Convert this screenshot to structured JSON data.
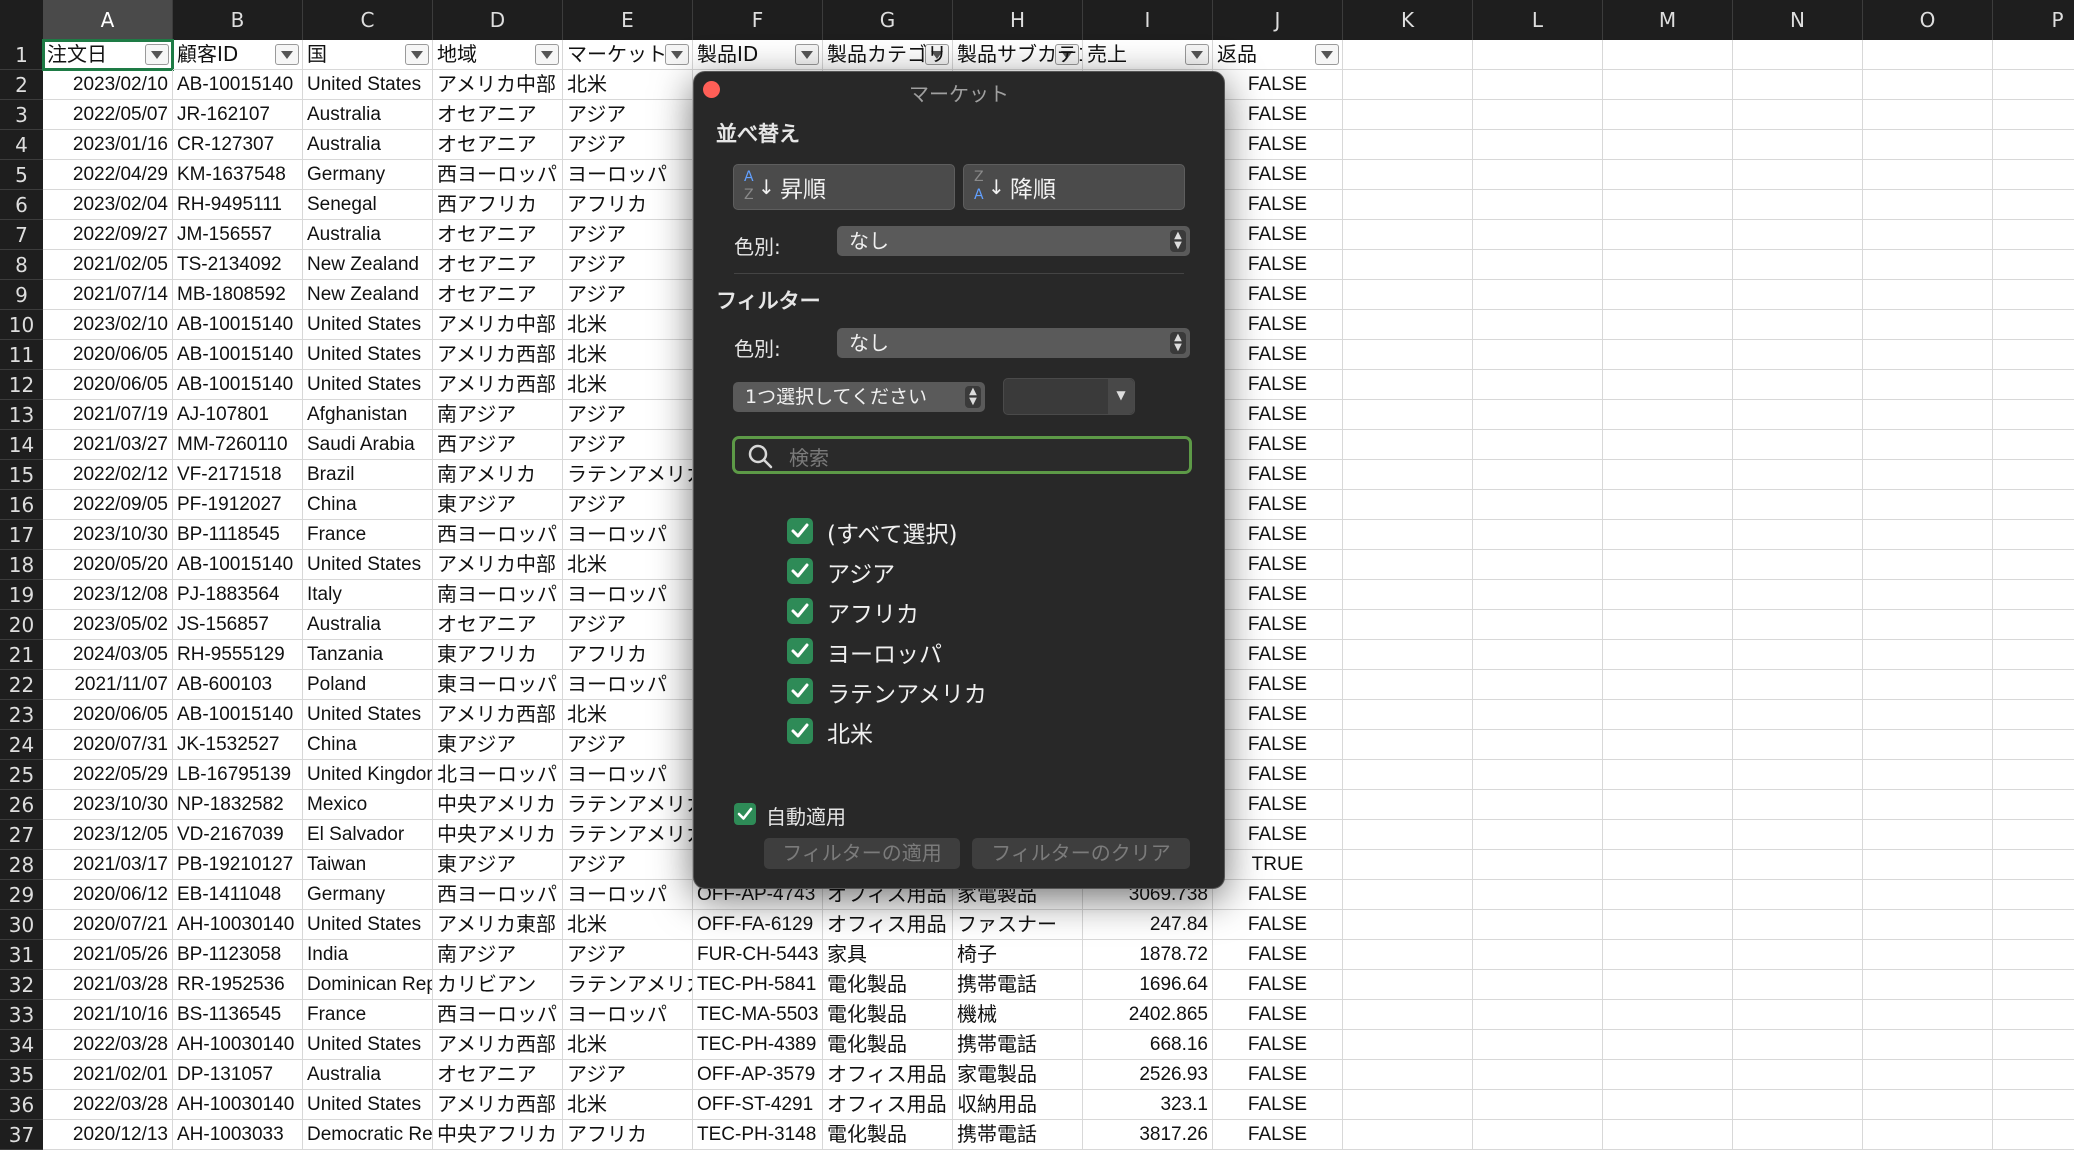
{
  "columns": [
    "A",
    "B",
    "C",
    "D",
    "E",
    "F",
    "G",
    "H",
    "I",
    "J",
    "K",
    "L",
    "M",
    "N",
    "O",
    "P"
  ],
  "selected_column": "A",
  "header_row": [
    "注文日",
    "顧客ID",
    "国",
    "地域",
    "マーケット",
    "製品ID",
    "製品カテゴリ",
    "製品サブカテゴリ",
    "売上",
    "返品"
  ],
  "rows": [
    [
      "1",
      "",
      "",
      "",
      "",
      "",
      "",
      "",
      "",
      ""
    ],
    [
      "2",
      "2023/02/10",
      "AB-10015140",
      "United States",
      "アメリカ中部",
      "北米",
      "",
      "",
      "",
      "FALSE"
    ],
    [
      "3",
      "2022/05/07",
      "JR-162107",
      "Australia",
      "オセアニア",
      "アジア",
      "",
      "",
      "",
      "FALSE"
    ],
    [
      "4",
      "2023/01/16",
      "CR-127307",
      "Australia",
      "オセアニア",
      "アジア",
      "",
      "",
      "",
      "FALSE"
    ],
    [
      "5",
      "2022/04/29",
      "KM-1637548",
      "Germany",
      "西ヨーロッパ",
      "ヨーロッパ",
      "",
      "",
      "",
      "FALSE"
    ],
    [
      "6",
      "2023/02/04",
      "RH-9495111",
      "Senegal",
      "西アフリカ",
      "アフリカ",
      "",
      "",
      "",
      "FALSE"
    ],
    [
      "7",
      "2022/09/27",
      "JM-156557",
      "Australia",
      "オセアニア",
      "アジア",
      "",
      "",
      "",
      "FALSE"
    ],
    [
      "8",
      "2021/02/05",
      "TS-2134092",
      "New Zealand",
      "オセアニア",
      "アジア",
      "",
      "",
      "",
      "FALSE"
    ],
    [
      "9",
      "2021/07/14",
      "MB-1808592",
      "New Zealand",
      "オセアニア",
      "アジア",
      "",
      "",
      "",
      "FALSE"
    ],
    [
      "10",
      "2023/02/10",
      "AB-10015140",
      "United States",
      "アメリカ中部",
      "北米",
      "",
      "",
      "",
      "FALSE"
    ],
    [
      "11",
      "2020/06/05",
      "AB-10015140",
      "United States",
      "アメリカ西部",
      "北米",
      "",
      "",
      "",
      "FALSE"
    ],
    [
      "12",
      "2020/06/05",
      "AB-10015140",
      "United States",
      "アメリカ西部",
      "北米",
      "",
      "",
      "",
      "FALSE"
    ],
    [
      "13",
      "2021/07/19",
      "AJ-107801",
      "Afghanistan",
      "南アジア",
      "アジア",
      "",
      "",
      "",
      "FALSE"
    ],
    [
      "14",
      "2021/03/27",
      "MM-7260110",
      "Saudi Arabia",
      "西アジア",
      "アジア",
      "",
      "",
      "",
      "FALSE"
    ],
    [
      "15",
      "2022/02/12",
      "VF-2171518",
      "Brazil",
      "南アメリカ",
      "ラテンアメリカ",
      "",
      "",
      "",
      "FALSE"
    ],
    [
      "16",
      "2022/09/05",
      "PF-1912027",
      "China",
      "東アジア",
      "アジア",
      "",
      "",
      "",
      "FALSE"
    ],
    [
      "17",
      "2023/10/30",
      "BP-1118545",
      "France",
      "西ヨーロッパ",
      "ヨーロッパ",
      "",
      "",
      "",
      "FALSE"
    ],
    [
      "18",
      "2020/05/20",
      "AB-10015140",
      "United States",
      "アメリカ中部",
      "北米",
      "",
      "",
      "",
      "FALSE"
    ],
    [
      "19",
      "2023/12/08",
      "PJ-1883564",
      "Italy",
      "南ヨーロッパ",
      "ヨーロッパ",
      "",
      "",
      "",
      "FALSE"
    ],
    [
      "20",
      "2023/05/02",
      "JS-156857",
      "Australia",
      "オセアニア",
      "アジア",
      "",
      "",
      "",
      "FALSE"
    ],
    [
      "21",
      "2024/03/05",
      "RH-9555129",
      "Tanzania",
      "東アフリカ",
      "アフリカ",
      "",
      "",
      "",
      "FALSE"
    ],
    [
      "22",
      "2021/11/07",
      "AB-600103",
      "Poland",
      "東ヨーロッパ",
      "ヨーロッパ",
      "",
      "",
      "",
      "FALSE"
    ],
    [
      "23",
      "2020/06/05",
      "AB-10015140",
      "United States",
      "アメリカ西部",
      "北米",
      "",
      "",
      "",
      "FALSE"
    ],
    [
      "24",
      "2020/07/31",
      "JK-1532527",
      "China",
      "東アジア",
      "アジア",
      "",
      "",
      "",
      "FALSE"
    ],
    [
      "25",
      "2022/05/29",
      "LB-16795139",
      "United Kingdom",
      "北ヨーロッパ",
      "ヨーロッパ",
      "",
      "",
      "",
      "FALSE"
    ],
    [
      "26",
      "2023/10/30",
      "NP-1832582",
      "Mexico",
      "中央アメリカ",
      "ラテンアメリカ",
      "",
      "",
      "",
      "FALSE"
    ],
    [
      "27",
      "2023/12/05",
      "VD-2167039",
      "El Salvador",
      "中央アメリカ",
      "ラテンアメリカ",
      "",
      "",
      "",
      "FALSE"
    ],
    [
      "28",
      "2021/03/17",
      "PB-19210127",
      "Taiwan",
      "東アジア",
      "アジア",
      "",
      "",
      "",
      "TRUE"
    ],
    [
      "29",
      "2020/06/12",
      "EB-1411048",
      "Germany",
      "西ヨーロッパ",
      "ヨーロッパ",
      "OFF-AP-4743",
      "オフィス用品",
      "家電製品",
      "3069.738",
      "FALSE"
    ],
    [
      "30",
      "2020/07/21",
      "AH-10030140",
      "United States",
      "アメリカ東部",
      "北米",
      "OFF-FA-6129",
      "オフィス用品",
      "ファスナー",
      "247.84",
      "FALSE"
    ],
    [
      "31",
      "2021/05/26",
      "BP-1123058",
      "India",
      "南アジア",
      "アジア",
      "FUR-CH-5443",
      "家具",
      "椅子",
      "1878.72",
      "FALSE"
    ],
    [
      "32",
      "2021/03/28",
      "RR-1952536",
      "Dominican Republic",
      "カリビアン",
      "ラテンアメリカ",
      "TEC-PH-5841",
      "電化製品",
      "携帯電話",
      "1696.64",
      "FALSE"
    ],
    [
      "33",
      "2021/10/16",
      "BS-1136545",
      "France",
      "西ヨーロッパ",
      "ヨーロッパ",
      "TEC-MA-5503",
      "電化製品",
      "機械",
      "2402.865",
      "FALSE"
    ],
    [
      "34",
      "2022/03/28",
      "AH-10030140",
      "United States",
      "アメリカ西部",
      "北米",
      "TEC-PH-4389",
      "電化製品",
      "携帯電話",
      "668.16",
      "FALSE"
    ],
    [
      "35",
      "2021/02/01",
      "DP-131057",
      "Australia",
      "オセアニア",
      "アジア",
      "OFF-AP-3579",
      "オフィス用品",
      "家電製品",
      "2526.93",
      "FALSE"
    ],
    [
      "36",
      "2022/03/28",
      "AH-10030140",
      "United States",
      "アメリカ西部",
      "北米",
      "OFF-ST-4291",
      "オフィス用品",
      "収納用品",
      "323.1",
      "FALSE"
    ],
    [
      "37",
      "2020/12/13",
      "AH-1003033",
      "Democratic Republic",
      "中央アフリカ",
      "アフリカ",
      "TEC-PH-3148",
      "電化製品",
      "携帯電話",
      "3817.26",
      "FALSE"
    ]
  ],
  "dialog": {
    "title": "マーケット",
    "sort_section": "並べ替え",
    "sort_asc": "昇順",
    "sort_desc": "降順",
    "sort_icon_letters": [
      "A",
      "Z"
    ],
    "color_label": "色別:",
    "sort_color_value": "なし",
    "filter_section": "フィルター",
    "filter_color_label": "色別:",
    "filter_color_value": "なし",
    "condition_select": "1つ選択してください",
    "search_placeholder": "検索",
    "items": [
      "(すべて選択)",
      "アジア",
      "アフリカ",
      "ヨーロッパ",
      "ラテンアメリカ",
      "北米"
    ],
    "auto_apply": "自動適用",
    "apply_button": "フィルターの適用",
    "clear_button": "フィルターのクリア"
  },
  "colors": {
    "header_bg": "#1e1e1e",
    "dialog_bg": "#282828",
    "accent_green": "#2e8b57",
    "close_red": "#ff5f57"
  }
}
